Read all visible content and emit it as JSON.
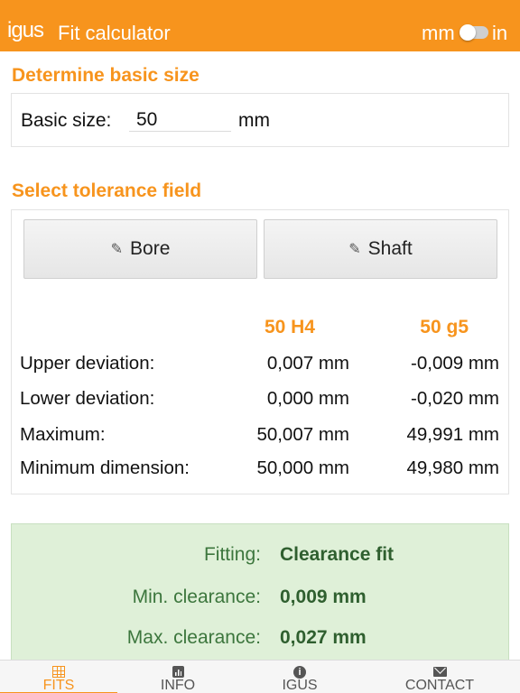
{
  "header": {
    "logo": "igus",
    "title": "Fit calculator",
    "unit_left": "mm",
    "unit_right": "in"
  },
  "basic": {
    "section_title": "Determine basic size",
    "label": "Basic size:",
    "value": "50",
    "unit": "mm"
  },
  "tolerance": {
    "section_title": "Select tolerance field",
    "bore_button": "Bore",
    "shaft_button": "Shaft",
    "col_bore": "50 H4",
    "col_shaft": "50 g5",
    "rows": [
      {
        "label": "Upper deviation:",
        "bore": "0,007 mm",
        "shaft": "-0,009 mm"
      },
      {
        "label": "Lower deviation:",
        "bore": "0,000 mm",
        "shaft": "-0,020 mm"
      },
      {
        "label": "Maximum:",
        "bore": "50,007 mm",
        "shaft": "49,991 mm"
      },
      {
        "label": "Minimum dimension:",
        "bore": "50,000 mm",
        "shaft": "49,980 mm"
      }
    ]
  },
  "fit": {
    "fitting_label": "Fitting:",
    "fitting_value": "Clearance fit",
    "min_label": "Min. clearance:",
    "min_value": "0,009 mm",
    "max_label": "Max. clearance:",
    "max_value": "0,027 mm"
  },
  "tabs": [
    {
      "label": "FITS",
      "icon": "grid-icon"
    },
    {
      "label": "INFO",
      "icon": "chart-icon"
    },
    {
      "label": "IGUS",
      "icon": "info-icon"
    },
    {
      "label": "CONTACT",
      "icon": "mail-icon"
    }
  ],
  "colors": {
    "accent": "#f7941d",
    "fit_background": "#dff0d8",
    "fit_text": "#3c763d"
  }
}
